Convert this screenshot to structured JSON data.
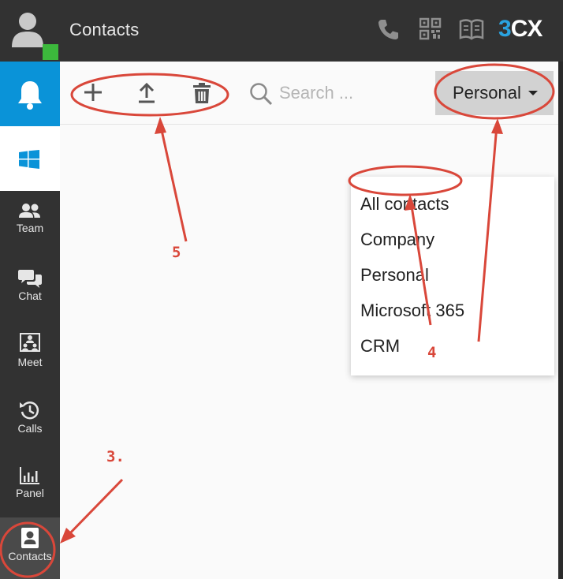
{
  "header": {
    "title": "Contacts",
    "logo": {
      "prefix": "3",
      "suffix": "CX"
    },
    "icons": [
      "phone-icon",
      "qr-code-icon",
      "book-icon"
    ]
  },
  "sidebar": {
    "items": [
      {
        "name": "notifications",
        "label": "",
        "icon": "bell-icon"
      },
      {
        "name": "windows",
        "label": "",
        "icon": "windows-icon"
      },
      {
        "name": "team",
        "label": "Team",
        "icon": "team-icon"
      },
      {
        "name": "chat",
        "label": "Chat",
        "icon": "chat-icon"
      },
      {
        "name": "meet",
        "label": "Meet",
        "icon": "meet-icon"
      },
      {
        "name": "calls",
        "label": "Calls",
        "icon": "calls-history-icon"
      },
      {
        "name": "panel",
        "label": "Panel",
        "icon": "panel-chart-icon"
      },
      {
        "name": "contacts",
        "label": "Contacts",
        "icon": "contacts-icon"
      }
    ]
  },
  "toolbar": {
    "buttons": [
      "add-icon",
      "upload-icon",
      "trash-icon"
    ],
    "search_placeholder": "Search ...",
    "filter_selected": "Personal"
  },
  "dropdown": {
    "options": [
      "All contacts",
      "Company",
      "Personal",
      "Microsoft 365",
      "CRM"
    ]
  },
  "annotations": {
    "labels": [
      "3.",
      "4",
      "5"
    ],
    "color": "#d9473a"
  },
  "colors": {
    "topbar": "#323232",
    "accent_blue": "#0a93d8",
    "presence_green": "#3cb93c"
  }
}
